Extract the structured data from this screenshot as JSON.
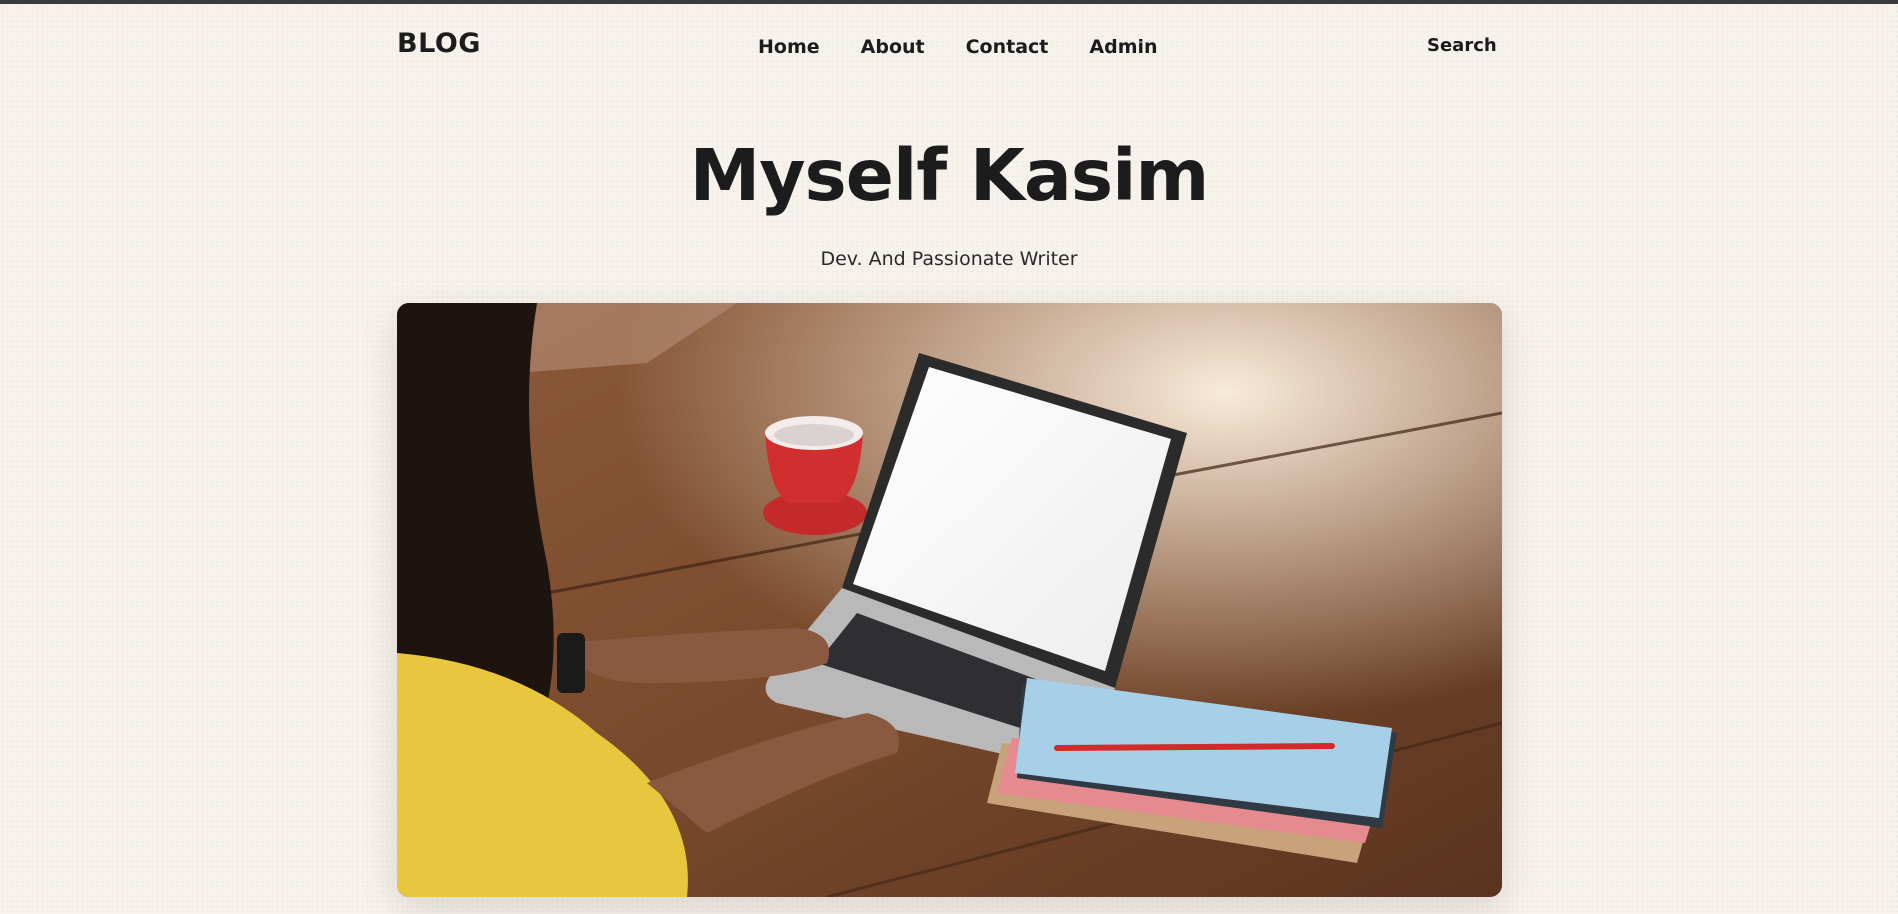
{
  "header": {
    "logo": "BLOG",
    "nav": [
      "Home",
      "About",
      "Contact",
      "Admin"
    ],
    "search_label": "Search"
  },
  "hero": {
    "title": "Myself Kasim",
    "subtitle": "Dev. And Passionate Writer"
  },
  "image": {
    "subject": "woman typing on laptop at wooden table with red coffee cup and notebooks"
  },
  "colors": {
    "background": "#f7f2ec",
    "text": "#1c1c1c",
    "top_border": "#3a3a3a"
  }
}
